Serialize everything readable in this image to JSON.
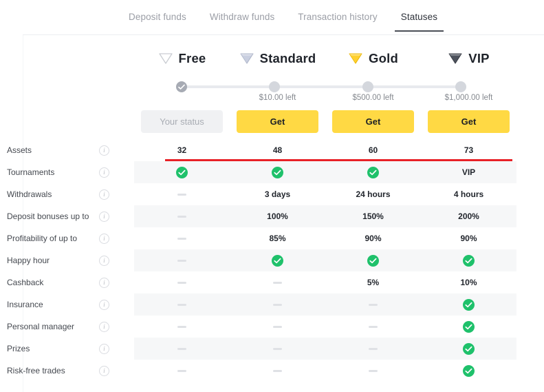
{
  "tabs": [
    {
      "label": "Deposit funds",
      "active": false
    },
    {
      "label": "Withdraw funds",
      "active": false
    },
    {
      "label": "Transaction history",
      "active": false
    },
    {
      "label": "Statuses",
      "active": true
    }
  ],
  "tiers": [
    {
      "name": "Free",
      "icon": "diamond-outline-icon",
      "color": "#ffffff",
      "stroke": "#c9ccd2"
    },
    {
      "name": "Standard",
      "icon": "diamond-silver-icon",
      "color": "#c9cfe0",
      "stroke": "#aab2c6"
    },
    {
      "name": "Gold",
      "icon": "diamond-gold-icon",
      "color": "#ffd02e",
      "stroke": "#e8b400"
    },
    {
      "name": "VIP",
      "icon": "diamond-black-icon",
      "color": "#4d525c",
      "stroke": "#343841"
    }
  ],
  "progress": {
    "nodes": [
      {
        "completed": true,
        "label": ""
      },
      {
        "completed": false,
        "label": "$10.00 left"
      },
      {
        "completed": false,
        "label": "$500.00 left"
      },
      {
        "completed": false,
        "label": "$1,000.00 left"
      }
    ]
  },
  "actions": [
    {
      "label": "Your status",
      "kind": "status"
    },
    {
      "label": "Get",
      "kind": "get"
    },
    {
      "label": "Get",
      "kind": "get"
    },
    {
      "label": "Get",
      "kind": "get"
    }
  ],
  "table": {
    "info_icon": "i",
    "rows": [
      {
        "label": "Assets",
        "shaded": false,
        "highlight": true,
        "cells": [
          {
            "type": "text",
            "value": "32"
          },
          {
            "type": "text",
            "value": "48"
          },
          {
            "type": "text",
            "value": "60"
          },
          {
            "type": "text",
            "value": "73"
          }
        ]
      },
      {
        "label": "Tournaments",
        "shaded": true,
        "highlight": false,
        "cells": [
          {
            "type": "check",
            "value": ""
          },
          {
            "type": "check",
            "value": ""
          },
          {
            "type": "check",
            "value": ""
          },
          {
            "type": "text",
            "value": "VIP"
          }
        ]
      },
      {
        "label": "Withdrawals",
        "shaded": false,
        "highlight": false,
        "cells": [
          {
            "type": "dash",
            "value": ""
          },
          {
            "type": "text",
            "value": "3 days"
          },
          {
            "type": "text",
            "value": "24 hours"
          },
          {
            "type": "text",
            "value": "4 hours"
          }
        ]
      },
      {
        "label": "Deposit bonuses up to",
        "shaded": true,
        "highlight": false,
        "cells": [
          {
            "type": "dash",
            "value": ""
          },
          {
            "type": "text",
            "value": "100%"
          },
          {
            "type": "text",
            "value": "150%"
          },
          {
            "type": "text",
            "value": "200%"
          }
        ]
      },
      {
        "label": "Profitability of up to",
        "shaded": false,
        "highlight": false,
        "cells": [
          {
            "type": "dash",
            "value": ""
          },
          {
            "type": "text",
            "value": "85%"
          },
          {
            "type": "text",
            "value": "90%"
          },
          {
            "type": "text",
            "value": "90%"
          }
        ]
      },
      {
        "label": "Happy hour",
        "shaded": true,
        "highlight": false,
        "cells": [
          {
            "type": "dash",
            "value": ""
          },
          {
            "type": "check",
            "value": ""
          },
          {
            "type": "check",
            "value": ""
          },
          {
            "type": "check",
            "value": ""
          }
        ]
      },
      {
        "label": "Cashback",
        "shaded": false,
        "highlight": false,
        "cells": [
          {
            "type": "dash",
            "value": ""
          },
          {
            "type": "dash",
            "value": ""
          },
          {
            "type": "text",
            "value": "5%"
          },
          {
            "type": "text",
            "value": "10%"
          }
        ]
      },
      {
        "label": "Insurance",
        "shaded": true,
        "highlight": false,
        "cells": [
          {
            "type": "dash",
            "value": ""
          },
          {
            "type": "dash",
            "value": ""
          },
          {
            "type": "dash",
            "value": ""
          },
          {
            "type": "check",
            "value": ""
          }
        ]
      },
      {
        "label": "Personal manager",
        "shaded": false,
        "highlight": false,
        "cells": [
          {
            "type": "dash",
            "value": ""
          },
          {
            "type": "dash",
            "value": ""
          },
          {
            "type": "dash",
            "value": ""
          },
          {
            "type": "check",
            "value": ""
          }
        ]
      },
      {
        "label": "Prizes",
        "shaded": true,
        "highlight": false,
        "cells": [
          {
            "type": "dash",
            "value": ""
          },
          {
            "type": "dash",
            "value": ""
          },
          {
            "type": "dash",
            "value": ""
          },
          {
            "type": "check",
            "value": ""
          }
        ]
      },
      {
        "label": "Risk-free trades",
        "shaded": false,
        "highlight": false,
        "cells": [
          {
            "type": "dash",
            "value": ""
          },
          {
            "type": "dash",
            "value": ""
          },
          {
            "type": "dash",
            "value": ""
          },
          {
            "type": "check",
            "value": ""
          }
        ]
      }
    ]
  },
  "colors": {
    "accent_yellow": "#ffd944",
    "check_green": "#1fc16b",
    "highlight_red": "#e82127",
    "tab_active": "#2f333b",
    "row_shade": "#f6f7f8"
  }
}
